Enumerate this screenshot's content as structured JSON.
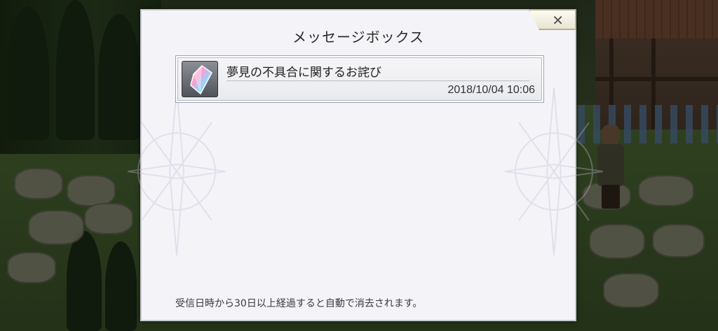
{
  "dialog": {
    "title": "メッセージボックス",
    "close_icon": "close-x-icon",
    "footer_note": "受信日時から30日以上経過すると自動で消去されます。"
  },
  "messages": [
    {
      "icon": "crystal-icon",
      "subject": "夢見の不具合に関するお詫び",
      "received": "2018/10/04 10:06"
    }
  ]
}
